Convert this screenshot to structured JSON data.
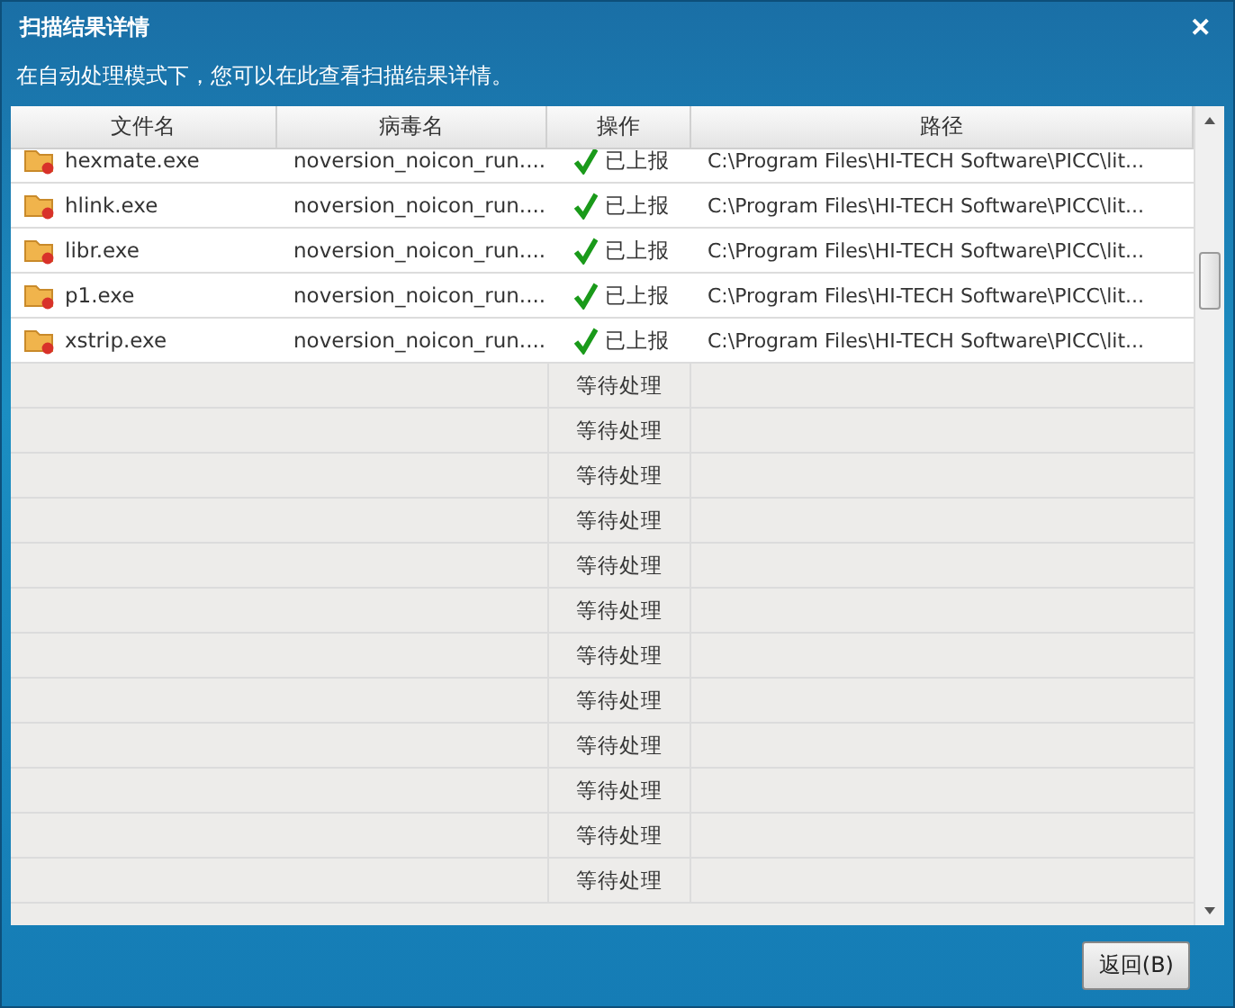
{
  "window": {
    "title": "扫描结果详情",
    "close": "✕"
  },
  "description": "在自动处理模式下，您可以在此查看扫描结果详情。",
  "table": {
    "columns": [
      "文件名",
      "病毒名",
      "操作",
      "路径"
    ],
    "rows": [
      {
        "kind": "reported",
        "file": "hexmate.exe",
        "virus": "noversion_noicon_run....",
        "action": "已上报",
        "path": "C:\\Program Files\\HI-TECH Software\\PICC\\lit..."
      },
      {
        "kind": "reported",
        "file": "hlink.exe",
        "virus": "noversion_noicon_run....",
        "action": "已上报",
        "path": "C:\\Program Files\\HI-TECH Software\\PICC\\lit..."
      },
      {
        "kind": "reported",
        "file": "libr.exe",
        "virus": "noversion_noicon_run....",
        "action": "已上报",
        "path": "C:\\Program Files\\HI-TECH Software\\PICC\\lit..."
      },
      {
        "kind": "reported",
        "file": "p1.exe",
        "virus": "noversion_noicon_run....",
        "action": "已上报",
        "path": "C:\\Program Files\\HI-TECH Software\\PICC\\lit..."
      },
      {
        "kind": "reported",
        "file": "xstrip.exe",
        "virus": "noversion_noicon_run....",
        "action": "已上报",
        "path": "C:\\Program Files\\HI-TECH Software\\PICC\\lit..."
      },
      {
        "kind": "pending",
        "action": "等待处理"
      },
      {
        "kind": "pending",
        "action": "等待处理"
      },
      {
        "kind": "pending",
        "action": "等待处理"
      },
      {
        "kind": "pending",
        "action": "等待处理"
      },
      {
        "kind": "pending",
        "action": "等待处理"
      },
      {
        "kind": "pending",
        "action": "等待处理"
      },
      {
        "kind": "pending",
        "action": "等待处理"
      },
      {
        "kind": "pending",
        "action": "等待处理"
      },
      {
        "kind": "pending",
        "action": "等待处理"
      },
      {
        "kind": "pending",
        "action": "等待处理"
      },
      {
        "kind": "pending",
        "action": "等待处理"
      },
      {
        "kind": "pending",
        "action": "等待处理"
      }
    ]
  },
  "buttons": [
    "返回(B)"
  ]
}
